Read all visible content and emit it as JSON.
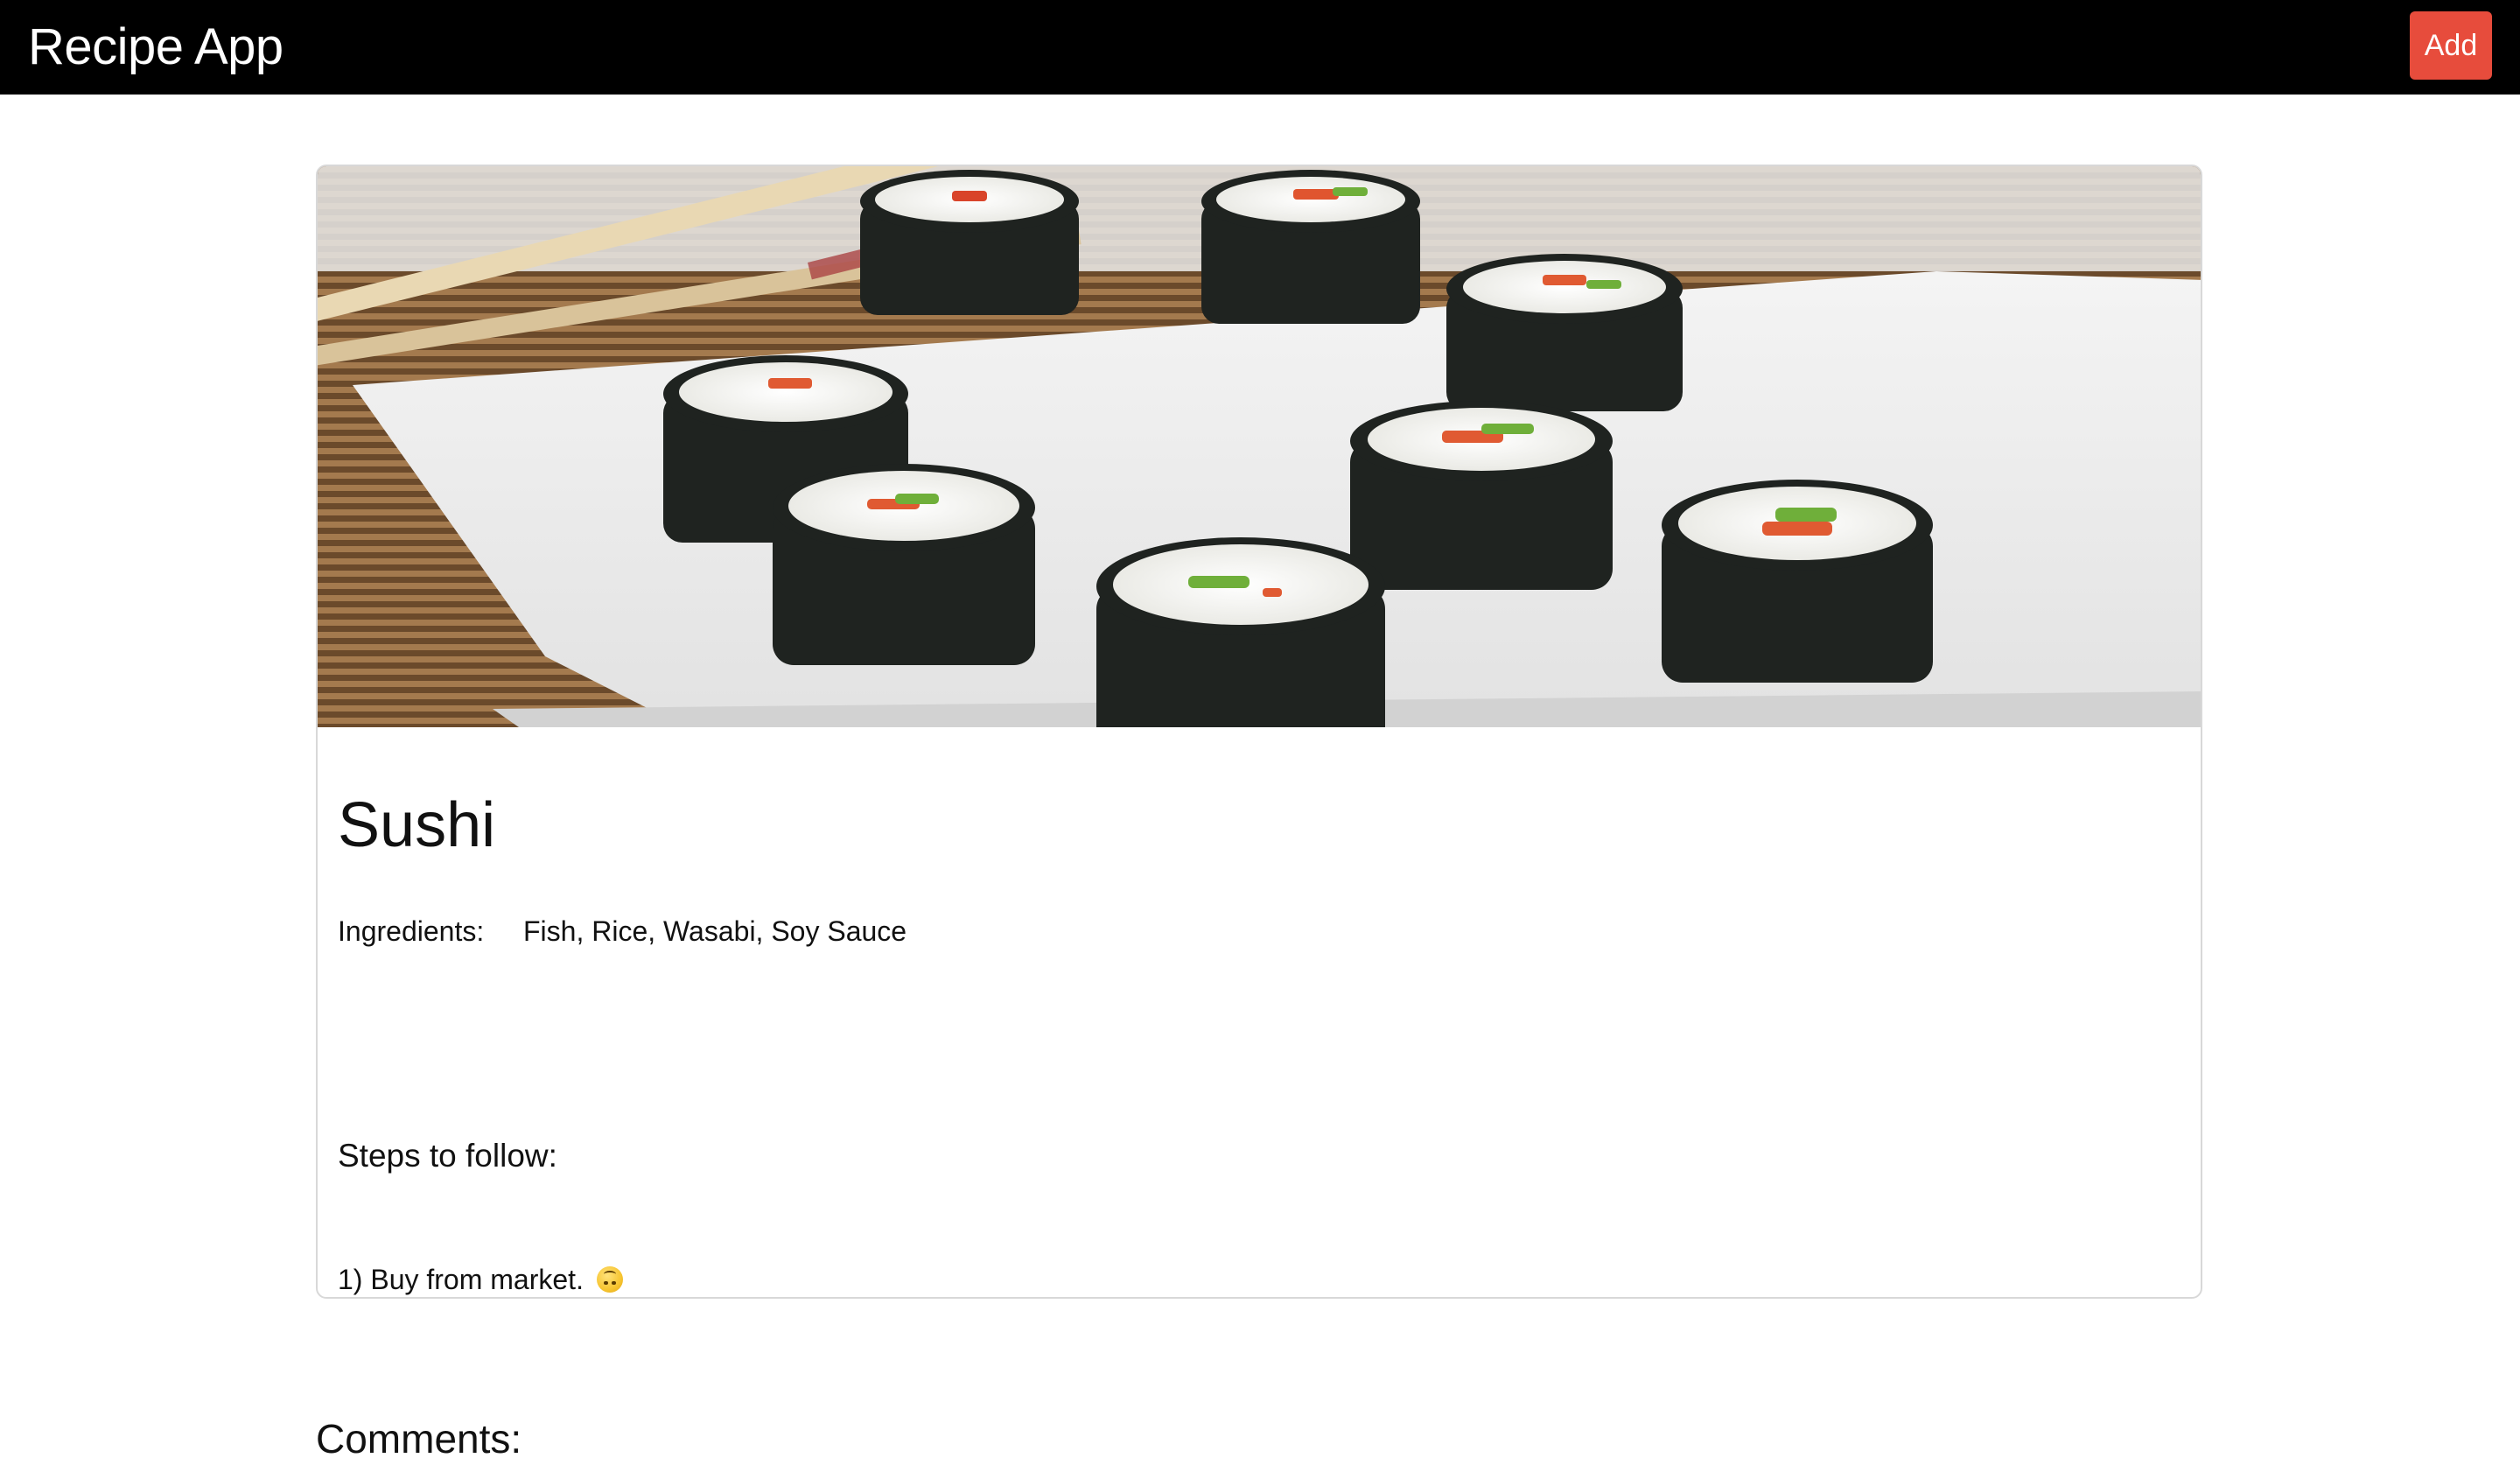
{
  "navbar": {
    "brand": "Recipe App",
    "add_label": "Add"
  },
  "recipe": {
    "image_alt": "Sushi rolls on a white plate with chopsticks",
    "title": "Sushi",
    "ingredients_label": "Ingredients:",
    "ingredients_value": "Fish, Rice, Wasabi, Soy Sauce",
    "steps_heading": "Steps to follow:",
    "steps": [
      "1) Buy from market."
    ],
    "step_emoji_icon": "upside-down-face-icon"
  },
  "comments": {
    "heading": "Comments:"
  },
  "colors": {
    "navbar_bg": "#000000",
    "add_button_bg": "#e74c3c",
    "card_border": "#d8d8d8"
  }
}
